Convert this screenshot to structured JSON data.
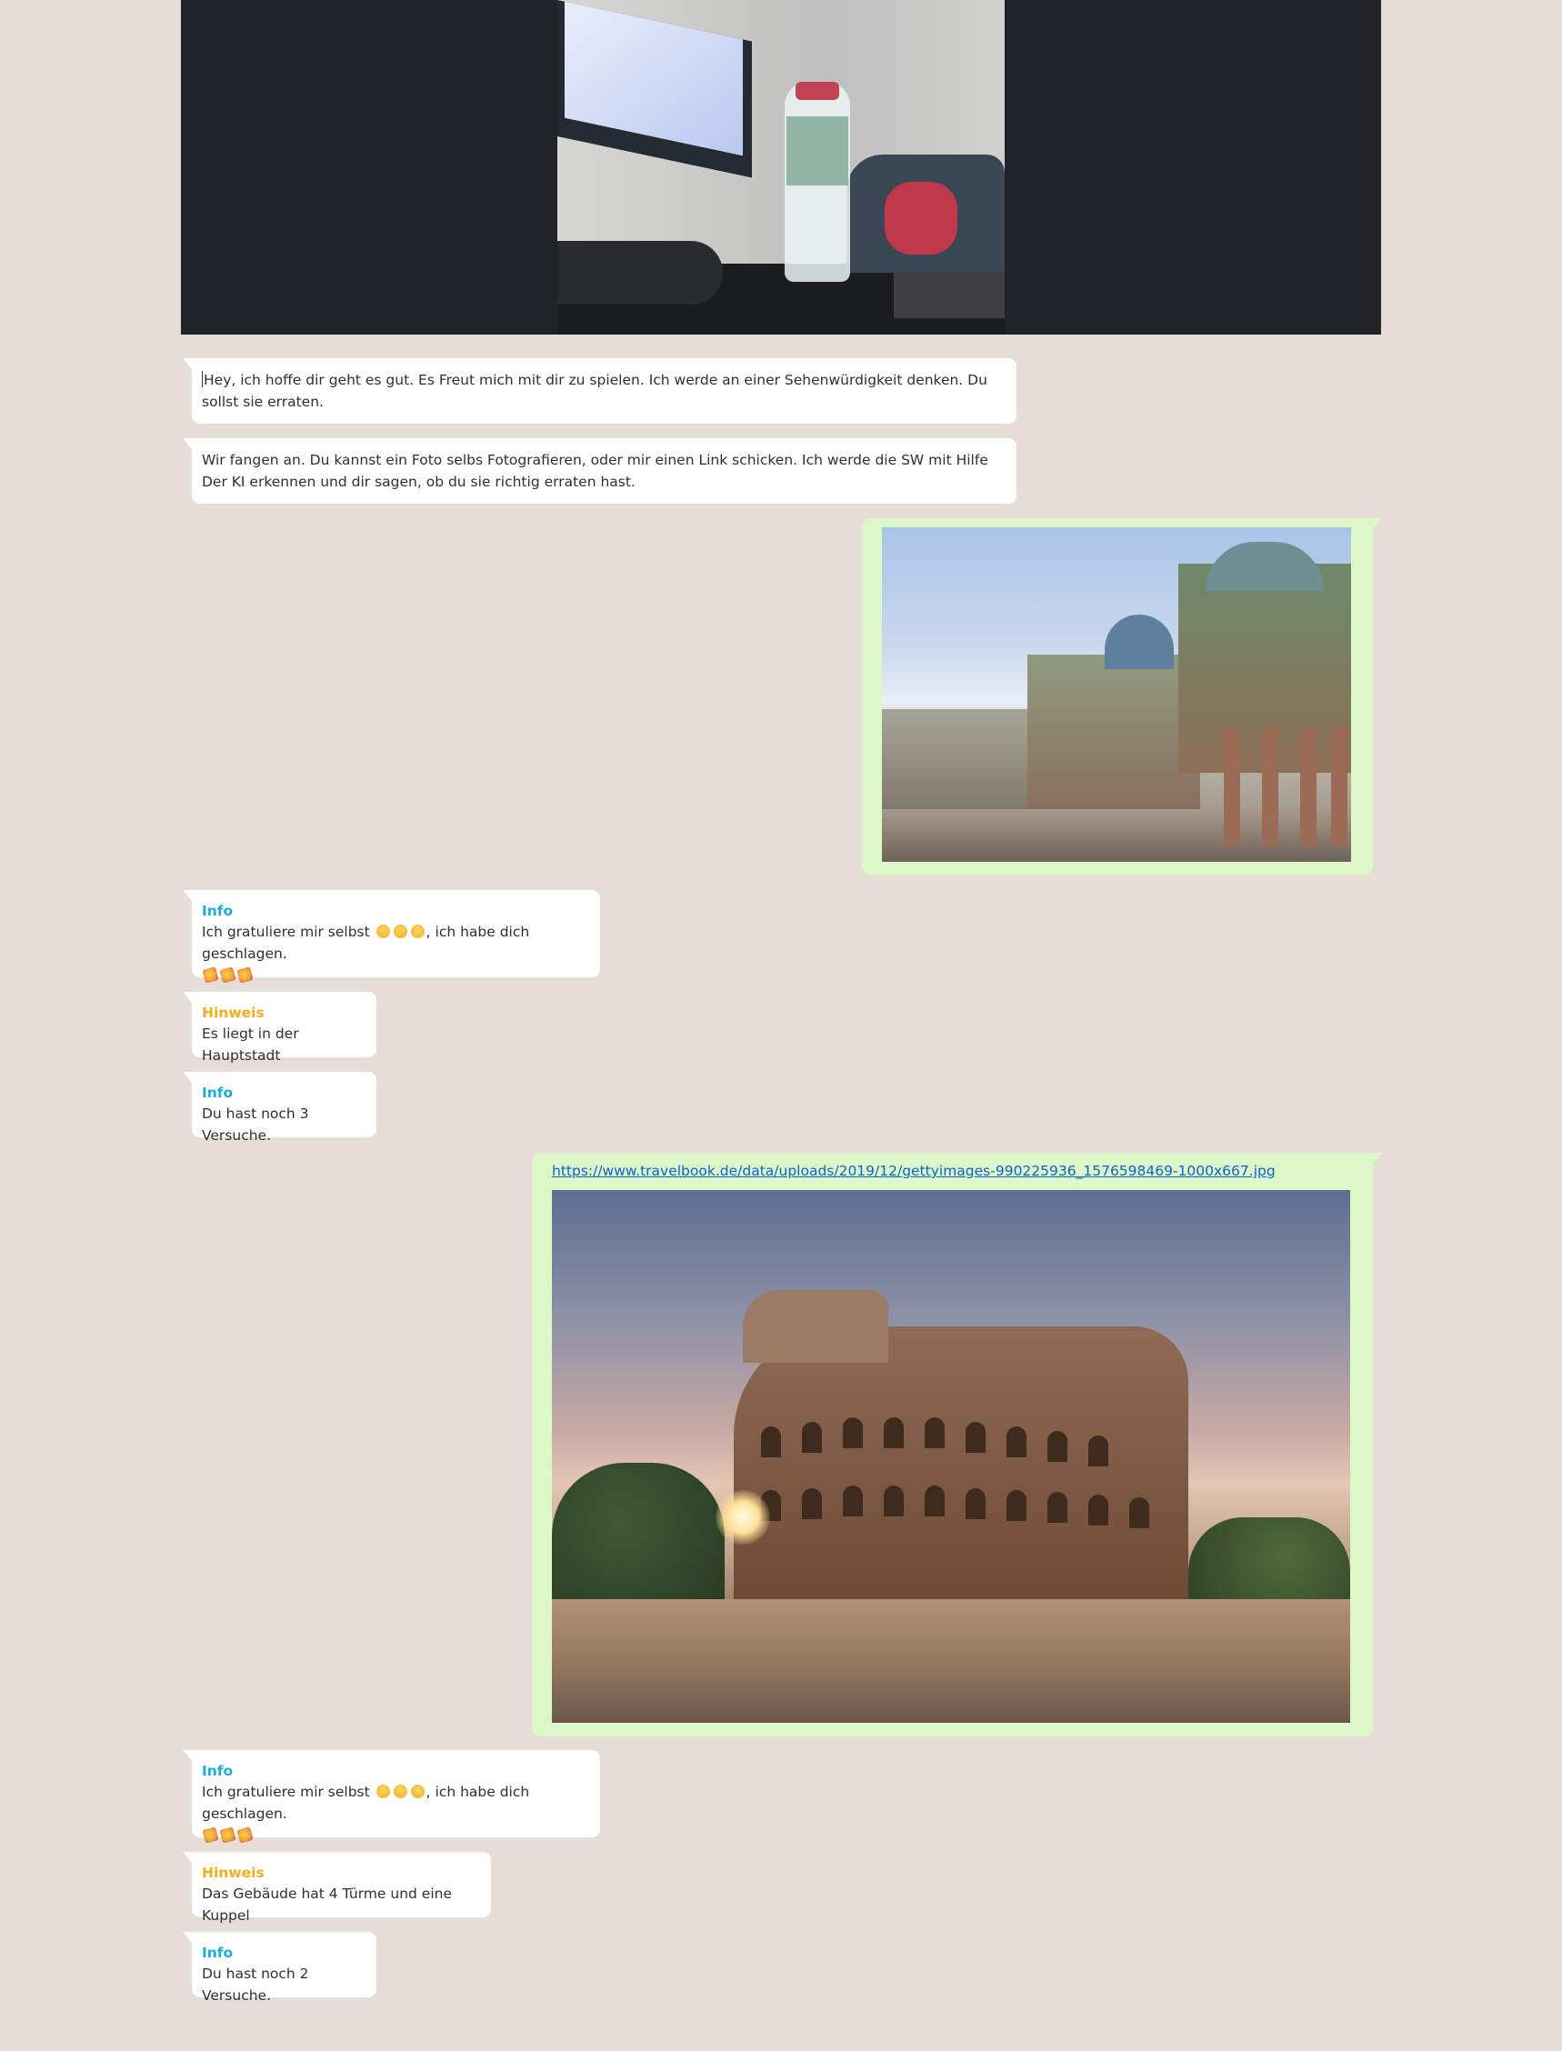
{
  "camera": {
    "alt": "camera-preview"
  },
  "messages": [
    {
      "text": "Hey, ich hoffe dir geht es gut. Es Freut mich mit dir zu spielen. Ich werde an einer Sehenwürdigkeit denken. Du sollst sie erraten."
    },
    {
      "text": "Wir fangen an. Du kannst ein Foto selbs Fotografieren, oder mir einen Link schicken. Ich werde die SW mit Hilfe Der KI erkennen und dir sagen, ob du sie richtig erraten hast."
    }
  ],
  "info1": {
    "sender": "Info",
    "text_before": "Ich gratuliere mir selbst",
    "text_after": ", ich habe dich geschlagen."
  },
  "hint1": {
    "sender": "Hinweis",
    "text": "Es liegt in der Hauptstadt"
  },
  "info2": {
    "sender": "Info",
    "text": "Du hast noch 3 Versuche."
  },
  "link_msg": {
    "url": "https://www.travelbook.de/data/uploads/2019/12/gettyimages-990225936_1576598469-1000x667.jpg"
  },
  "info3": {
    "sender": "Info",
    "text_before": "Ich gratuliere mir selbst",
    "text_after": ", ich habe dich geschlagen."
  },
  "hint2": {
    "sender": "Hinweis",
    "text": "Das Gebäude hat 4 Türme und eine Kuppel"
  },
  "info4": {
    "sender": "Info",
    "text": "Du hast noch 2 Versuche."
  },
  "colors": {
    "background": "#e5ddd6",
    "outgoing": "#dcf8c6",
    "incoming": "#ffffff",
    "info": "#1aaed7",
    "hint": "#f4ad1f",
    "link": "#0b63d1"
  }
}
